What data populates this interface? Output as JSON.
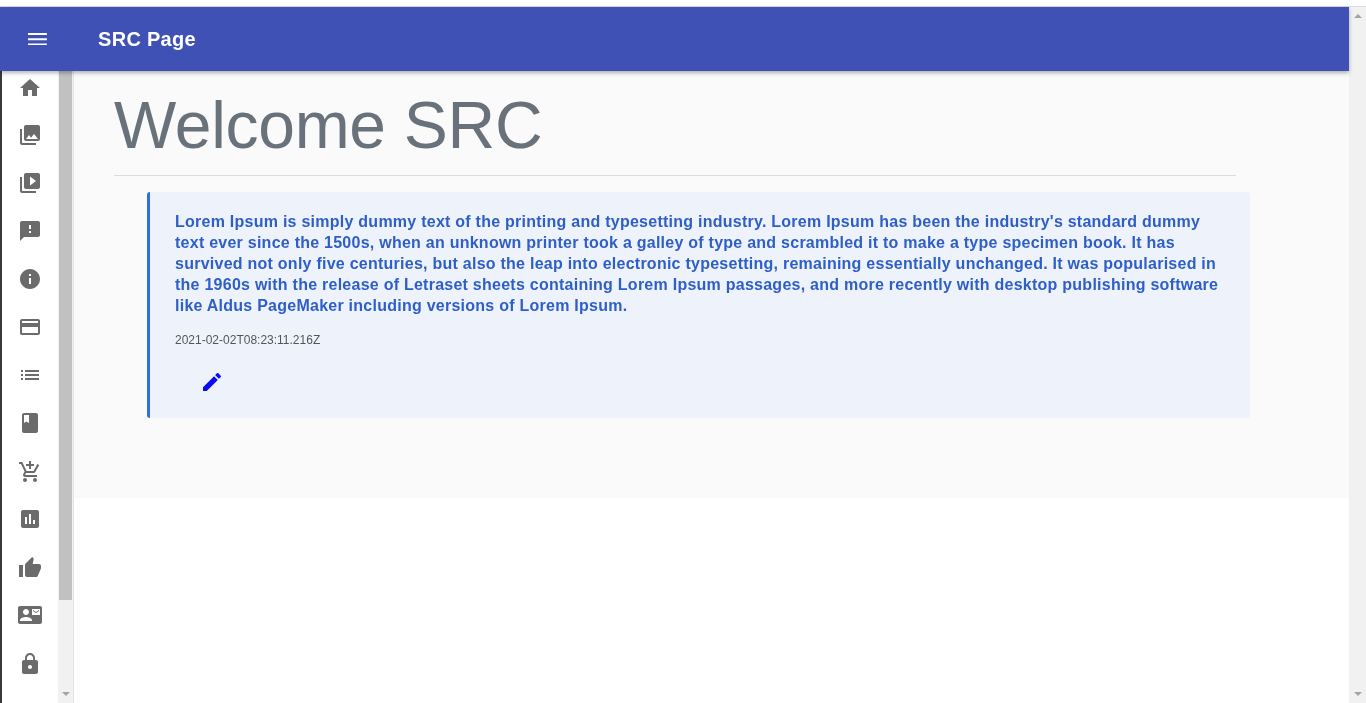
{
  "top_bar": {
    "title": "SRC Page"
  },
  "sidebar": {
    "items": [
      {
        "kind": "home"
      },
      {
        "kind": "images"
      },
      {
        "kind": "videos"
      },
      {
        "kind": "feedback"
      },
      {
        "kind": "info"
      },
      {
        "kind": "card"
      },
      {
        "kind": "list"
      },
      {
        "kind": "book"
      },
      {
        "kind": "cart"
      },
      {
        "kind": "chart"
      },
      {
        "kind": "thumb"
      },
      {
        "kind": "contact"
      },
      {
        "kind": "lock"
      }
    ]
  },
  "main": {
    "heading": "Welcome SRC",
    "post": {
      "text": "Lorem Ipsum is simply dummy text of the printing and typesetting industry. Lorem Ipsum has been the industry's standard dummy text ever since the 1500s, when an unknown printer took a galley of type and scrambled it to make a type specimen book. It has survived not only five centuries, but also the leap into electronic typesetting, remaining essentially unchanged. It was popularised in the 1960s with the release of Letraset sheets containing Lorem Ipsum passages, and more recently with desktop publishing software like Aldus PageMaker including versions of Lorem Ipsum.",
      "timestamp": "2021-02-02T08:23:11.216Z"
    }
  }
}
